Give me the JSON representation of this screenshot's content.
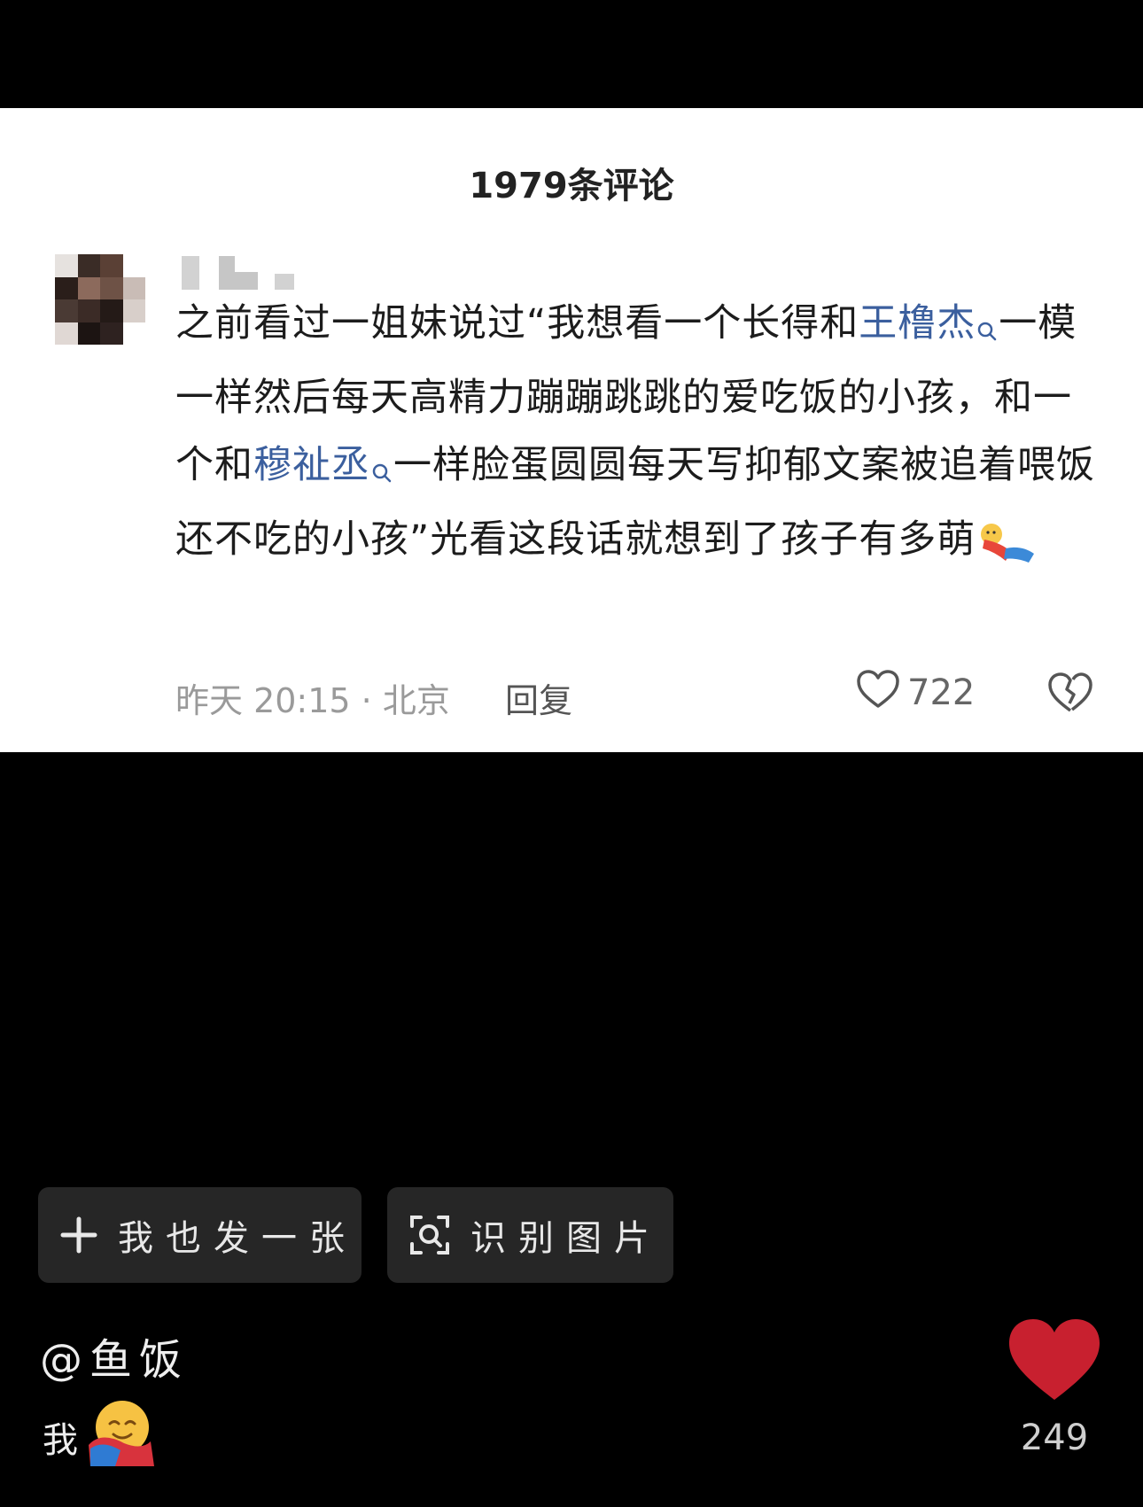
{
  "comments_panel": {
    "title": "1979条评论",
    "comment": {
      "text_parts": [
        "之前看过一姐妹说过“我想看一个长得和",
        "王橹杰",
        "一模一样然后每天高精力蹦蹦跳跳的爱吃饭的小孩，和一个和",
        "穆祉丞",
        "一样脸蛋圆圆每天写抑郁文案被追着喂饭还不吃的小孩”光看这段话就想到了孩子有多萌"
      ],
      "time_location": "昨天 20:15 · 北京",
      "reply_label": "回复",
      "like_count": "722"
    }
  },
  "bottom": {
    "post_button_label": "我也发一张",
    "recognize_button_label": "识别图片",
    "author": "@鱼饭",
    "caption": "我",
    "heart_count": "249"
  },
  "icons": {
    "search": "search-icon",
    "like": "heart-outline-icon",
    "dislike": "broken-heart-icon",
    "plus": "plus-icon",
    "scan": "scan-icon",
    "big_heart": "heart-filled-icon",
    "hug_emoji": "hug-emoji-icon",
    "dizzy_emoji": "dizzy-fall-emoji-icon"
  },
  "colors": {
    "keyword_link": "#3b5f9e",
    "heart_red": "#c8202f",
    "button_bg": "#262626"
  }
}
